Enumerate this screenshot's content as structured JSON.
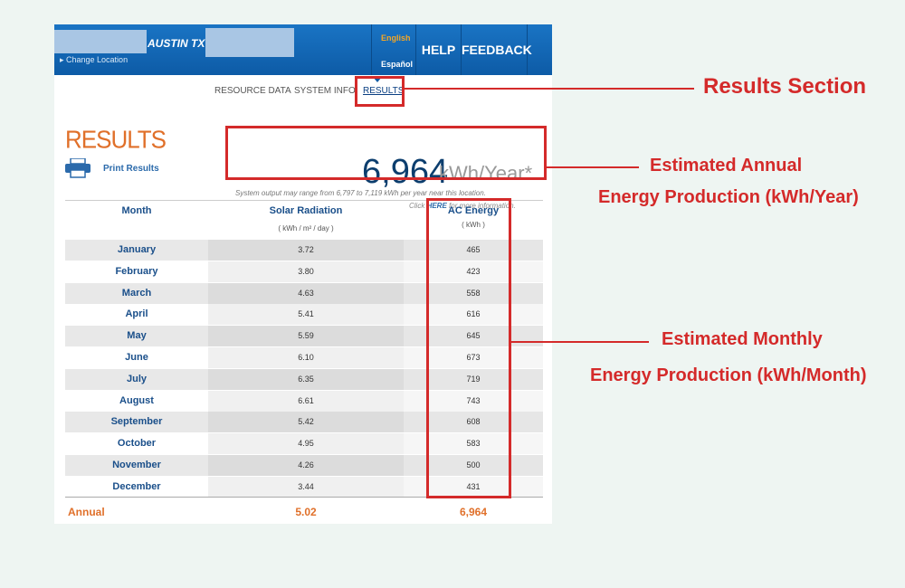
{
  "header": {
    "location": "AUSTIN TX",
    "change_location": "▸ Change Location",
    "lang_english": "English",
    "lang_espanol": "Español",
    "help": "HELP",
    "feedback": "FEEDBACK"
  },
  "tabs": [
    "RESOURCE DATA",
    "SYSTEM INFO",
    "RESULTS"
  ],
  "results": {
    "title": "RESULTS",
    "print_label": "Print Results",
    "total_value": "6,964",
    "total_unit": "kWh/Year*",
    "range_note": "System output may range from 6,797 to 7,119 kWh per year near this location.",
    "click_prefix": "Click ",
    "click_link": "HERE",
    "click_suffix": " for more information."
  },
  "table": {
    "col_month": "Month",
    "col_radiation": "Solar Radiation",
    "col_radiation_unit": "( kWh / m² / day )",
    "col_ac": "AC Energy",
    "col_ac_unit": "( kWh )",
    "rows": [
      {
        "month": "January",
        "rad": "3.72",
        "ac": "465"
      },
      {
        "month": "February",
        "rad": "3.80",
        "ac": "423"
      },
      {
        "month": "March",
        "rad": "4.63",
        "ac": "558"
      },
      {
        "month": "April",
        "rad": "5.41",
        "ac": "616"
      },
      {
        "month": "May",
        "rad": "5.59",
        "ac": "645"
      },
      {
        "month": "June",
        "rad": "6.10",
        "ac": "673"
      },
      {
        "month": "July",
        "rad": "6.35",
        "ac": "719"
      },
      {
        "month": "August",
        "rad": "6.61",
        "ac": "743"
      },
      {
        "month": "September",
        "rad": "5.42",
        "ac": "608"
      },
      {
        "month": "October",
        "rad": "4.95",
        "ac": "583"
      },
      {
        "month": "November",
        "rad": "4.26",
        "ac": "500"
      },
      {
        "month": "December",
        "rad": "3.44",
        "ac": "431"
      }
    ],
    "annual_label": "Annual",
    "annual_rad": "5.02",
    "annual_ac": "6,964"
  },
  "annotations": {
    "results_section": "Results Section",
    "annual_line1": "Estimated Annual",
    "annual_line2": "Energy Production (kWh/Year)",
    "monthly_line1": "Estimated Monthly",
    "monthly_line2": "Energy Production (kWh/Month)"
  },
  "colors": {
    "header_blue": "#0d5ba6",
    "accent_orange": "#e0702a",
    "annotation_red": "#d42a2a",
    "month_blue": "#1a4f8a"
  }
}
